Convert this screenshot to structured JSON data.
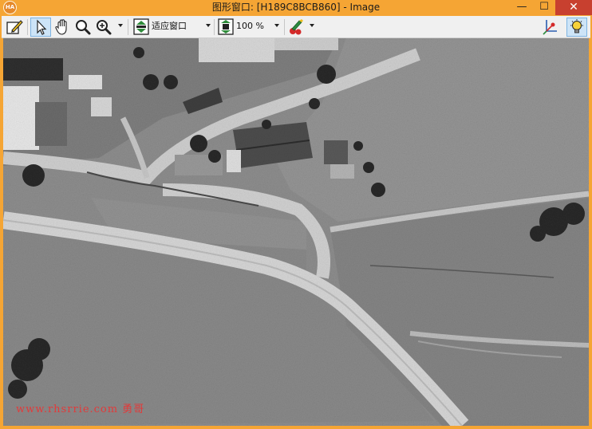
{
  "window": {
    "title": "图形窗口: [H189C8BCB860] - Image",
    "app_icon_text": "HA",
    "controls": {
      "minimize": "—",
      "maximize": "☐",
      "close": "✕"
    }
  },
  "toolbar": {
    "fit_window_label": "适应窗口",
    "zoom_label": "100 %",
    "tools": [
      "edit-icon",
      "pointer-icon",
      "hand-icon",
      "magnifier-icon",
      "zoom-icon",
      "fit-window-icon",
      "zoom-percent-icon",
      "color-icon",
      "axis-icon",
      "lightbulb-icon"
    ]
  },
  "image": {
    "description_icon": "aerial-photo",
    "watermark": "www.rhsrrie.com 勇哥"
  },
  "colors": {
    "title_bar": "#f5a534",
    "close_button": "#c8402f",
    "toolbar": "#f0f0f0",
    "selected_tool": "#cde4f7",
    "watermark": "#e23a3a"
  }
}
